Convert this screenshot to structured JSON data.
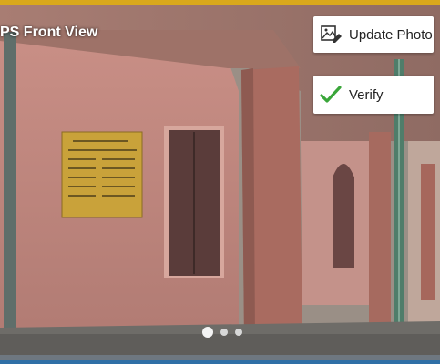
{
  "photo": {
    "title": "PS Front View",
    "slide_count": 3,
    "active_slide": 1
  },
  "actions": {
    "update_photo": {
      "label": "Update Photo",
      "icon": "image-edit-icon"
    },
    "verify": {
      "label": "Verify",
      "icon": "check-icon",
      "color": "#3aa63a"
    }
  },
  "colors": {
    "top_bar": "#d9a81c",
    "bottom_line": "#2f6fa6"
  }
}
